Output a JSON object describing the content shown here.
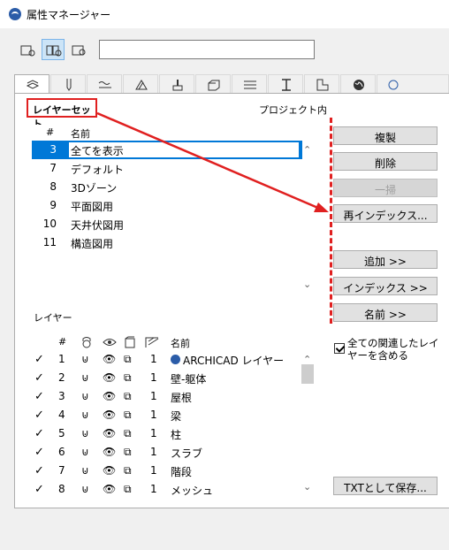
{
  "window": {
    "title": "属性マネージャー"
  },
  "layer_sets": {
    "label": "レイヤーセット",
    "scope": "プロジェクト内",
    "columns": {
      "num": "#",
      "name": "名前"
    },
    "rows": [
      {
        "num": "3",
        "name": "全てを表示"
      },
      {
        "num": "7",
        "name": "デフォルト"
      },
      {
        "num": "8",
        "name": "3Dゾーン"
      },
      {
        "num": "9",
        "name": "平面図用"
      },
      {
        "num": "10",
        "name": "天井伏図用"
      },
      {
        "num": "11",
        "name": "構造図用"
      }
    ]
  },
  "actions": {
    "duplicate": "複製",
    "delete": "削除",
    "purge": "一掃",
    "reindex": "再インデックス...",
    "add": "追加 >>",
    "index": "インデックス >>",
    "name": "名前 >>",
    "save_txt": "TXTとして保存..."
  },
  "layers": {
    "label": "レイヤー",
    "columns": {
      "num": "#",
      "name": "名前"
    },
    "include_related": "全ての関連したレイヤーを含める",
    "rows": [
      {
        "check": "✓",
        "num": "1",
        "pen": "1",
        "name": "ARCHICAD レイヤー"
      },
      {
        "check": "✓",
        "num": "2",
        "pen": "1",
        "name": "壁-躯体"
      },
      {
        "check": "✓",
        "num": "3",
        "pen": "1",
        "name": "屋根"
      },
      {
        "check": "✓",
        "num": "4",
        "pen": "1",
        "name": "梁"
      },
      {
        "check": "✓",
        "num": "5",
        "pen": "1",
        "name": "柱"
      },
      {
        "check": "✓",
        "num": "6",
        "pen": "1",
        "name": "スラブ"
      },
      {
        "check": "✓",
        "num": "7",
        "pen": "1",
        "name": "階段"
      },
      {
        "check": "✓",
        "num": "8",
        "pen": "1",
        "name": "メッシュ"
      }
    ]
  },
  "colors": {
    "accent_red": "#e02020",
    "selection": "#0078d7"
  }
}
